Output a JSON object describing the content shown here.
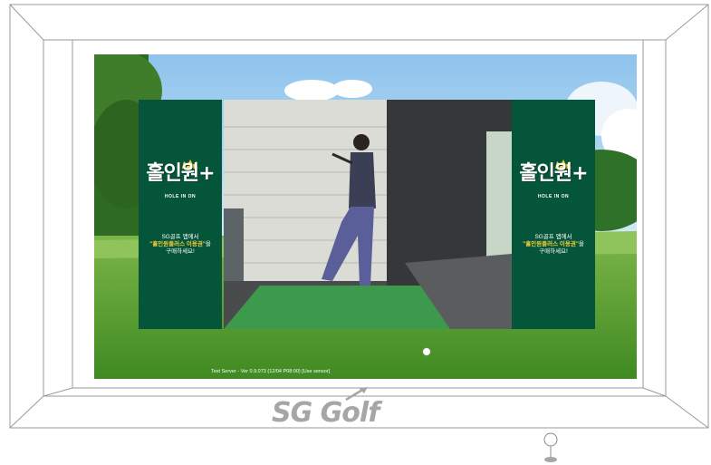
{
  "app": {
    "brand": "SG Golf"
  },
  "status_bar": {
    "text": "Test Server - Ver 0.9.073 (12/04 P08:00) [Use sensor]"
  },
  "promo_panel": {
    "logo_text": "홀인원",
    "logo_plus": "+",
    "logo_subtitle": "HOLE IN ON",
    "line1": "SG골프 앱에서",
    "line2_highlight": "\"홀인원플러스 이용권\"",
    "line2_suffix": "을",
    "line3": "구매하세요!"
  },
  "colors": {
    "panel_bg": "#05553a",
    "highlight": "#f2d13a",
    "fairway": "#4f9a2c",
    "brand_gray": "#a6a6a6"
  },
  "icons": {
    "pin": "location-pin-icon",
    "ball": "golf-ball-icon",
    "crown": "crown-icon"
  }
}
